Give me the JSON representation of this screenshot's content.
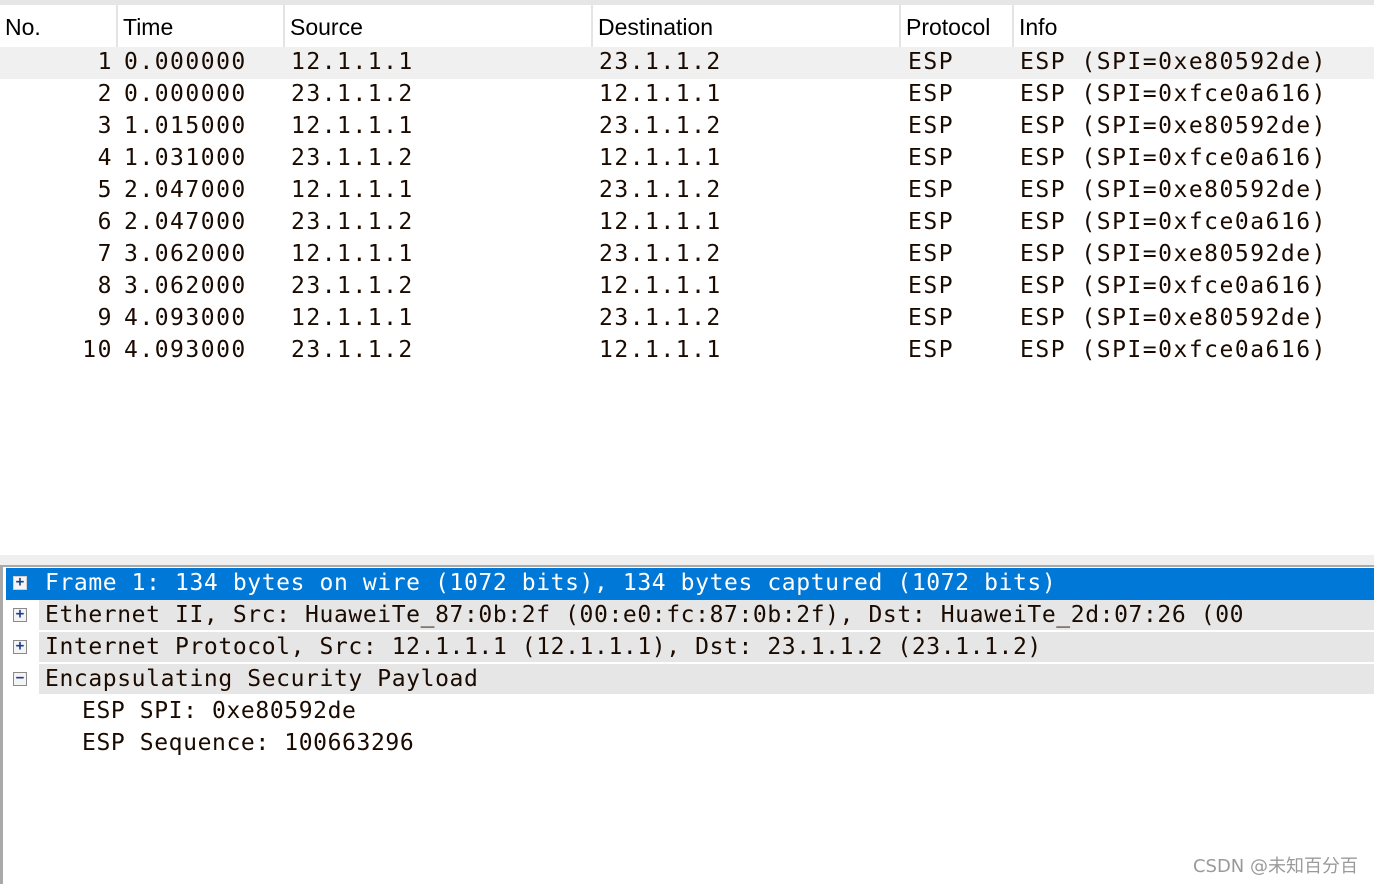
{
  "packet_list": {
    "columns": [
      "No.",
      "Time",
      "Source",
      "Destination",
      "Protocol",
      "Info"
    ],
    "selected_index": 0,
    "rows": [
      {
        "no": "1",
        "time": "0.000000",
        "source": "12.1.1.1",
        "destination": "23.1.1.2",
        "protocol": "ESP",
        "info": "ESP (SPI=0xe80592de)"
      },
      {
        "no": "2",
        "time": "0.000000",
        "source": "23.1.1.2",
        "destination": "12.1.1.1",
        "protocol": "ESP",
        "info": "ESP (SPI=0xfce0a616)"
      },
      {
        "no": "3",
        "time": "1.015000",
        "source": "12.1.1.1",
        "destination": "23.1.1.2",
        "protocol": "ESP",
        "info": "ESP (SPI=0xe80592de)"
      },
      {
        "no": "4",
        "time": "1.031000",
        "source": "23.1.1.2",
        "destination": "12.1.1.1",
        "protocol": "ESP",
        "info": "ESP (SPI=0xfce0a616)"
      },
      {
        "no": "5",
        "time": "2.047000",
        "source": "12.1.1.1",
        "destination": "23.1.1.2",
        "protocol": "ESP",
        "info": "ESP (SPI=0xe80592de)"
      },
      {
        "no": "6",
        "time": "2.047000",
        "source": "23.1.1.2",
        "destination": "12.1.1.1",
        "protocol": "ESP",
        "info": "ESP (SPI=0xfce0a616)"
      },
      {
        "no": "7",
        "time": "3.062000",
        "source": "12.1.1.1",
        "destination": "23.1.1.2",
        "protocol": "ESP",
        "info": "ESP (SPI=0xe80592de)"
      },
      {
        "no": "8",
        "time": "3.062000",
        "source": "23.1.1.2",
        "destination": "12.1.1.1",
        "protocol": "ESP",
        "info": "ESP (SPI=0xfce0a616)"
      },
      {
        "no": "9",
        "time": "4.093000",
        "source": "12.1.1.1",
        "destination": "23.1.1.2",
        "protocol": "ESP",
        "info": "ESP (SPI=0xe80592de)"
      },
      {
        "no": "10",
        "time": "4.093000",
        "source": "23.1.1.2",
        "destination": "12.1.1.1",
        "protocol": "ESP",
        "info": "ESP (SPI=0xfce0a616)"
      }
    ]
  },
  "packet_details": {
    "tree": [
      {
        "label": "Frame 1: 134 bytes on wire (1072 bits), 134 bytes captured (1072 bits)",
        "expander": "+",
        "state": "collapsed",
        "selected": true
      },
      {
        "label": "Ethernet II, Src: HuaweiTe_87:0b:2f (00:e0:fc:87:0b:2f), Dst: HuaweiTe_2d:07:26 (00",
        "expander": "+",
        "state": "collapsed",
        "selected": false
      },
      {
        "label": "Internet Protocol, Src: 12.1.1.1 (12.1.1.1), Dst: 23.1.1.2 (23.1.1.2)",
        "expander": "+",
        "state": "collapsed",
        "selected": false
      },
      {
        "label": "Encapsulating Security Payload",
        "expander": "−",
        "state": "expanded",
        "selected": false
      },
      {
        "label": "ESP SPI: 0xe80592de",
        "child": true
      },
      {
        "label": "ESP Sequence: 100663296",
        "child": true
      }
    ]
  },
  "colors": {
    "selection": "#0078d7",
    "row_highlight": "#f0f0f0",
    "tree_row_bg": "#e6e6e6"
  },
  "watermark": "CSDN @未知百分百"
}
